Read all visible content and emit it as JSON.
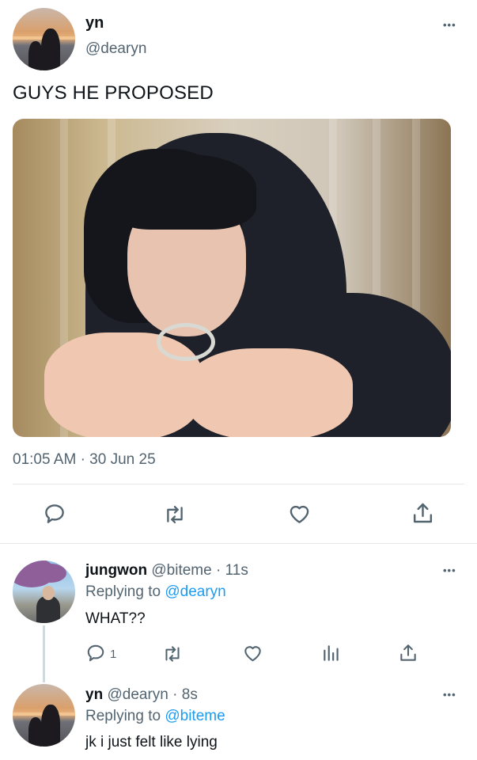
{
  "main_tweet": {
    "name": "yn",
    "handle": "@dearyn",
    "text": "GUYS HE PROPOSED",
    "time": "01:05 AM",
    "sep": "·",
    "date": "30 Jun 25",
    "more_label": "•••",
    "actions": [
      "reply-icon",
      "retweet-icon",
      "like-icon",
      "share-icon"
    ]
  },
  "replies": [
    {
      "name": "jungwon",
      "handle": "@biteme",
      "sep": "·",
      "time": "11s",
      "replying_prefix": "Replying to",
      "replying_to": "@dearyn",
      "text": "WHAT??",
      "reply_count": "1",
      "more_label": "•••",
      "actions": [
        "reply-icon",
        "retweet-icon",
        "like-icon",
        "analytics-icon",
        "share-icon"
      ]
    },
    {
      "name": "yn",
      "handle": "@dearyn",
      "sep": "·",
      "time": "8s",
      "replying_prefix": "Replying to",
      "replying_to": "@biteme",
      "text": "jk i just felt like lying",
      "more_label": "•••"
    }
  ],
  "colors": {
    "link": "#1d9bf0",
    "muted": "#536471",
    "divider": "#e6e9ec"
  }
}
